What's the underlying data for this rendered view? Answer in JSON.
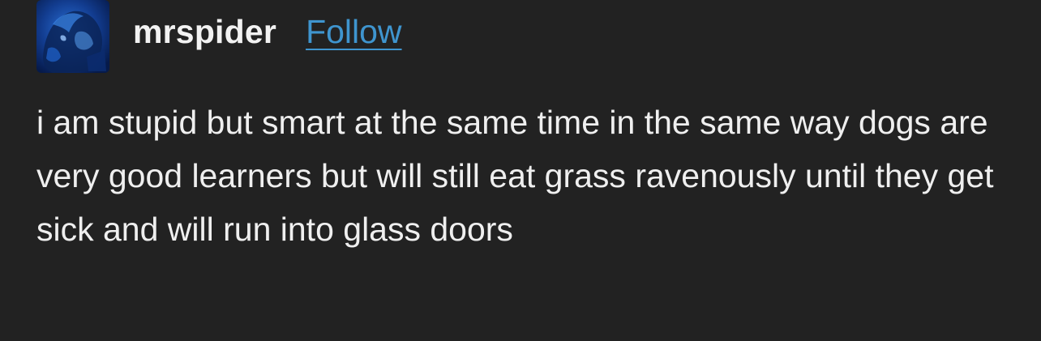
{
  "post": {
    "author": "mrspider",
    "follow_label": "Follow",
    "avatar_icon": "avatar-icon",
    "text": "i am stupid but smart at the same time in the same way dogs are very good learners but will still eat grass ravenously until they get sick and will run into glass doors"
  },
  "colors": {
    "background": "#222222",
    "link": "#3f95cf",
    "text": "#efefef"
  }
}
